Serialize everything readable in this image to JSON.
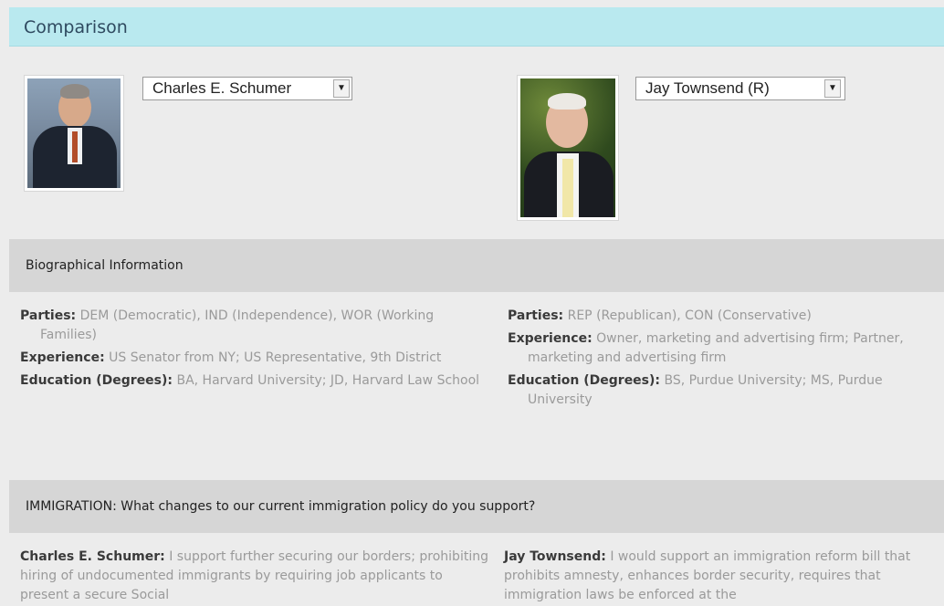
{
  "header": {
    "title": "Comparison"
  },
  "candidates": [
    {
      "selected": "Charles E. Schumer",
      "photo_alt": "Charles E. Schumer photo"
    },
    {
      "selected": "Jay Townsend (R)",
      "photo_alt": "Jay Townsend photo"
    }
  ],
  "bio": {
    "heading": "Biographical Information",
    "left": {
      "parties_label": "Parties:",
      "parties_value": "DEM (Democratic), IND (Independence), WOR (Working Families)",
      "experience_label": "Experience:",
      "experience_value": "US Senator from NY; US Representative, 9th District",
      "education_label": "Education (Degrees):",
      "education_value": "BA, Harvard University; JD, Harvard Law School"
    },
    "right": {
      "parties_label": "Parties:",
      "parties_value": "REP (Republican), CON (Conservative)",
      "experience_label": "Experience:",
      "experience_value": "Owner, marketing and advertising firm; Partner, marketing and advertising firm",
      "education_label": "Education (Degrees):",
      "education_value": "BS, Purdue University; MS, Purdue University"
    }
  },
  "immigration": {
    "heading": "IMMIGRATION: What changes to our current immigration policy do you support?",
    "left_label": "Charles E. Schumer:",
    "left_text": "I support further securing our borders; prohibiting hiring of undocumented immigrants by requiring job applicants to present a secure Social",
    "right_label": "Jay Townsend:",
    "right_text": "I would support an immigration reform bill that prohibits amnesty, enhances border security, requires that immigration laws be enforced at the"
  }
}
